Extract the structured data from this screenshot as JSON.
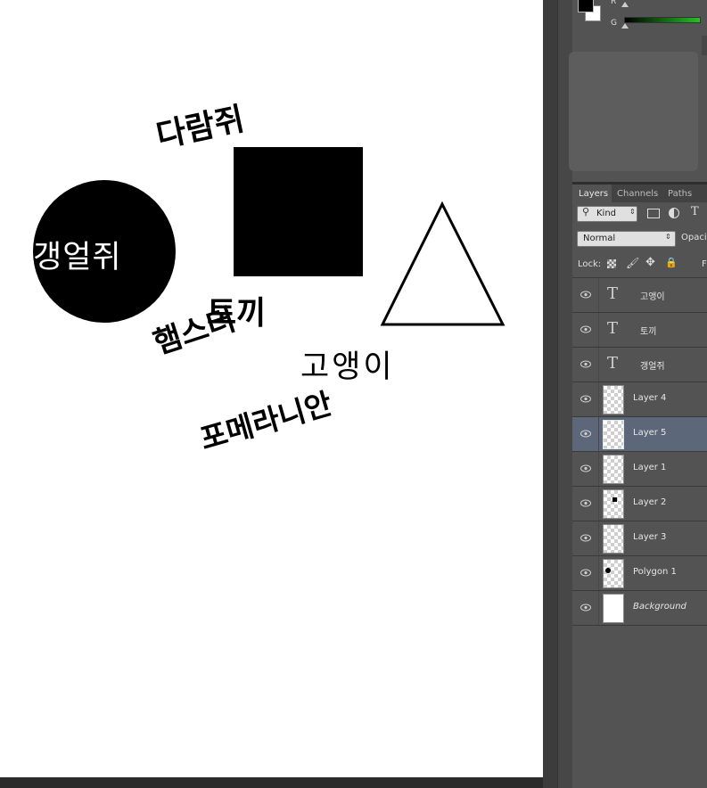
{
  "canvas": {
    "text_pomeranian": "포메라니안",
    "text_daramjwi": "다람쥐",
    "text_gaengeoljwi": "갱얼쥐",
    "text_tokki": "토끼",
    "text_hamster": "햄스터",
    "text_goaengi": "고앵이"
  },
  "color_panel": {
    "r_label": "R",
    "g_label": "G"
  },
  "layers_panel": {
    "tabs": [
      "Layers",
      "Channels",
      "Paths"
    ],
    "kind_label": "Kind",
    "blend_mode": "Normal",
    "opacity_label": "Opacit",
    "lock_label": "Lock:",
    "fill_label": "F",
    "text_icon": "T",
    "layers": [
      {
        "name": "고앵이",
        "type": "text"
      },
      {
        "name": "토끼",
        "type": "text"
      },
      {
        "name": "갱얼쥐",
        "type": "text"
      },
      {
        "name": "Layer 4",
        "type": "pixel"
      },
      {
        "name": "Layer 5",
        "type": "pixel",
        "selected": true
      },
      {
        "name": "Layer 1",
        "type": "pixel"
      },
      {
        "name": "Layer 2",
        "type": "pixel"
      },
      {
        "name": "Layer 3",
        "type": "pixel"
      },
      {
        "name": "Polygon 1",
        "type": "pixel"
      },
      {
        "name": "Background",
        "type": "background"
      }
    ]
  },
  "colors": {
    "canvas_bg": "#ffffff",
    "panel_bg": "#535353",
    "selected_row": "#5c6779",
    "green_slider": "#22c322"
  }
}
